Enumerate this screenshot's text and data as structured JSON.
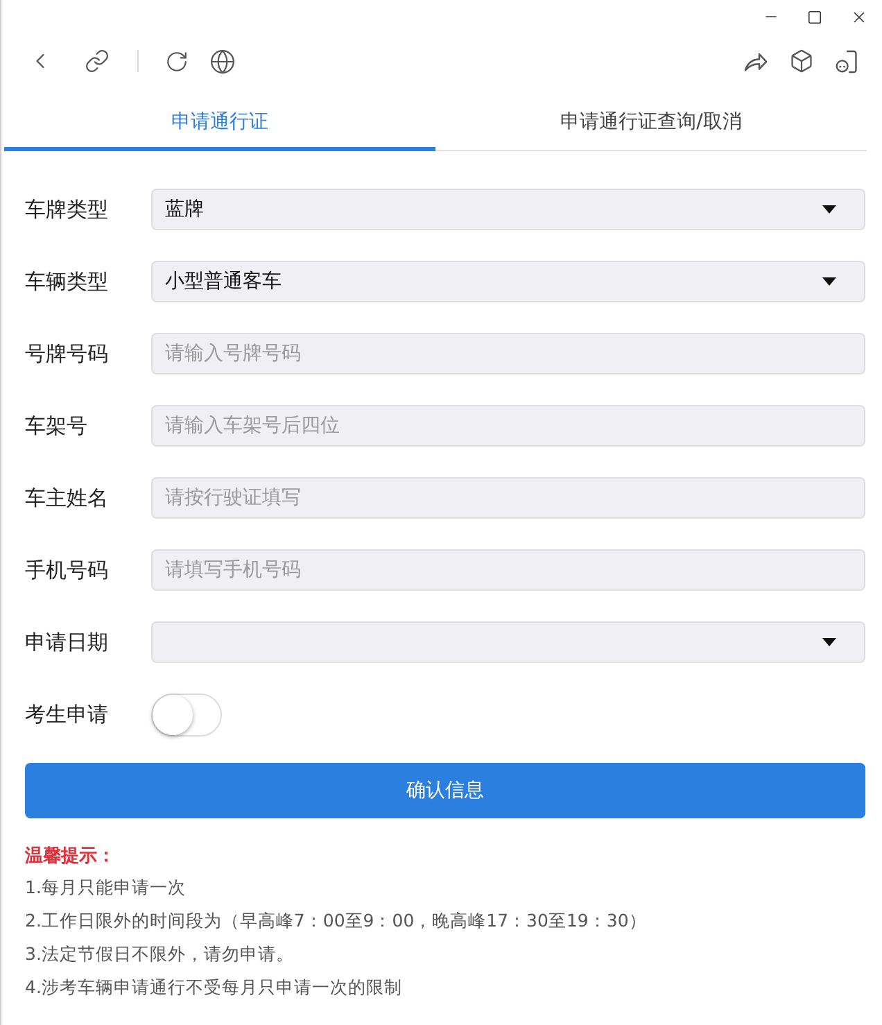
{
  "tabs": [
    {
      "label": "申请通行证",
      "selected": true
    },
    {
      "label": "申请通行证查询/取消",
      "selected": false
    }
  ],
  "form": {
    "fields": [
      {
        "kind": "select",
        "label": "车牌类型",
        "value": "蓝牌"
      },
      {
        "kind": "select",
        "label": "车辆类型",
        "value": "小型普通客车"
      },
      {
        "kind": "input",
        "label": "号牌号码",
        "placeholder": "请输入号牌号码"
      },
      {
        "kind": "input",
        "label": "车架号",
        "placeholder": "请输入车架号后四位"
      },
      {
        "kind": "input",
        "label": "车主姓名",
        "placeholder": "请按行驶证填写"
      },
      {
        "kind": "input",
        "label": "手机号码",
        "placeholder": "请填写手机号码"
      },
      {
        "kind": "select",
        "label": "申请日期"
      },
      {
        "kind": "toggle",
        "label": "考生申请",
        "on": false
      }
    ]
  },
  "confirm_button": {
    "label": "确认信息"
  },
  "tips": {
    "title": "温馨提示：",
    "items": [
      "1.每月只能申请一次",
      "2.工作日限外的时间段为（早高峰7：00至9：00，晚高峰17：30至19：30）",
      "3.法定节假日不限外，请勿申请。",
      "4.涉考车辆申请通行不受每月只申请一次的限制"
    ]
  }
}
